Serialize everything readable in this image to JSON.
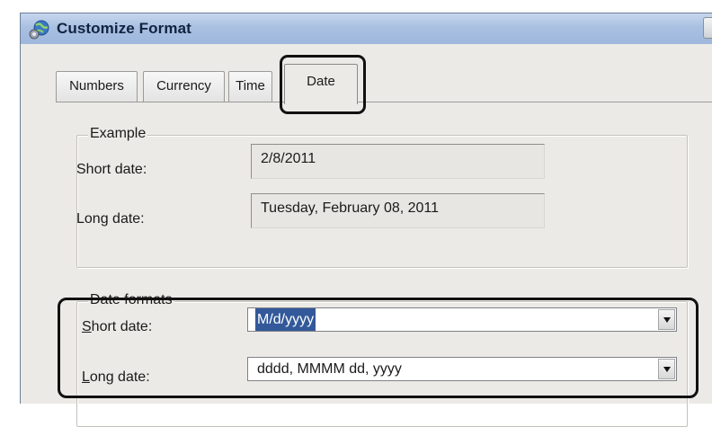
{
  "window": {
    "title": "Customize Format",
    "icon": "globe-settings-icon"
  },
  "tabs": [
    {
      "label": "Numbers",
      "selected": false
    },
    {
      "label": "Currency",
      "selected": false
    },
    {
      "label": "Time",
      "selected": false
    },
    {
      "label": "Date",
      "selected": true
    }
  ],
  "example": {
    "title": "Example",
    "short_label": "Short date:",
    "short_value": "2/8/2011",
    "long_label": "Long date:",
    "long_value": "Tuesday, February 08, 2011"
  },
  "formats": {
    "title": "Date formats",
    "short_label_access": "S",
    "short_label_rest": "hort date:",
    "short_value": "M/d/yyyy",
    "long_label_access": "L",
    "long_label_rest": "ong date:",
    "long_value": "dddd, MMMM dd, yyyy"
  },
  "colors": {
    "selection": "#33599a",
    "titlebar": "#a9c0e2",
    "dialog": "#eceae6"
  }
}
